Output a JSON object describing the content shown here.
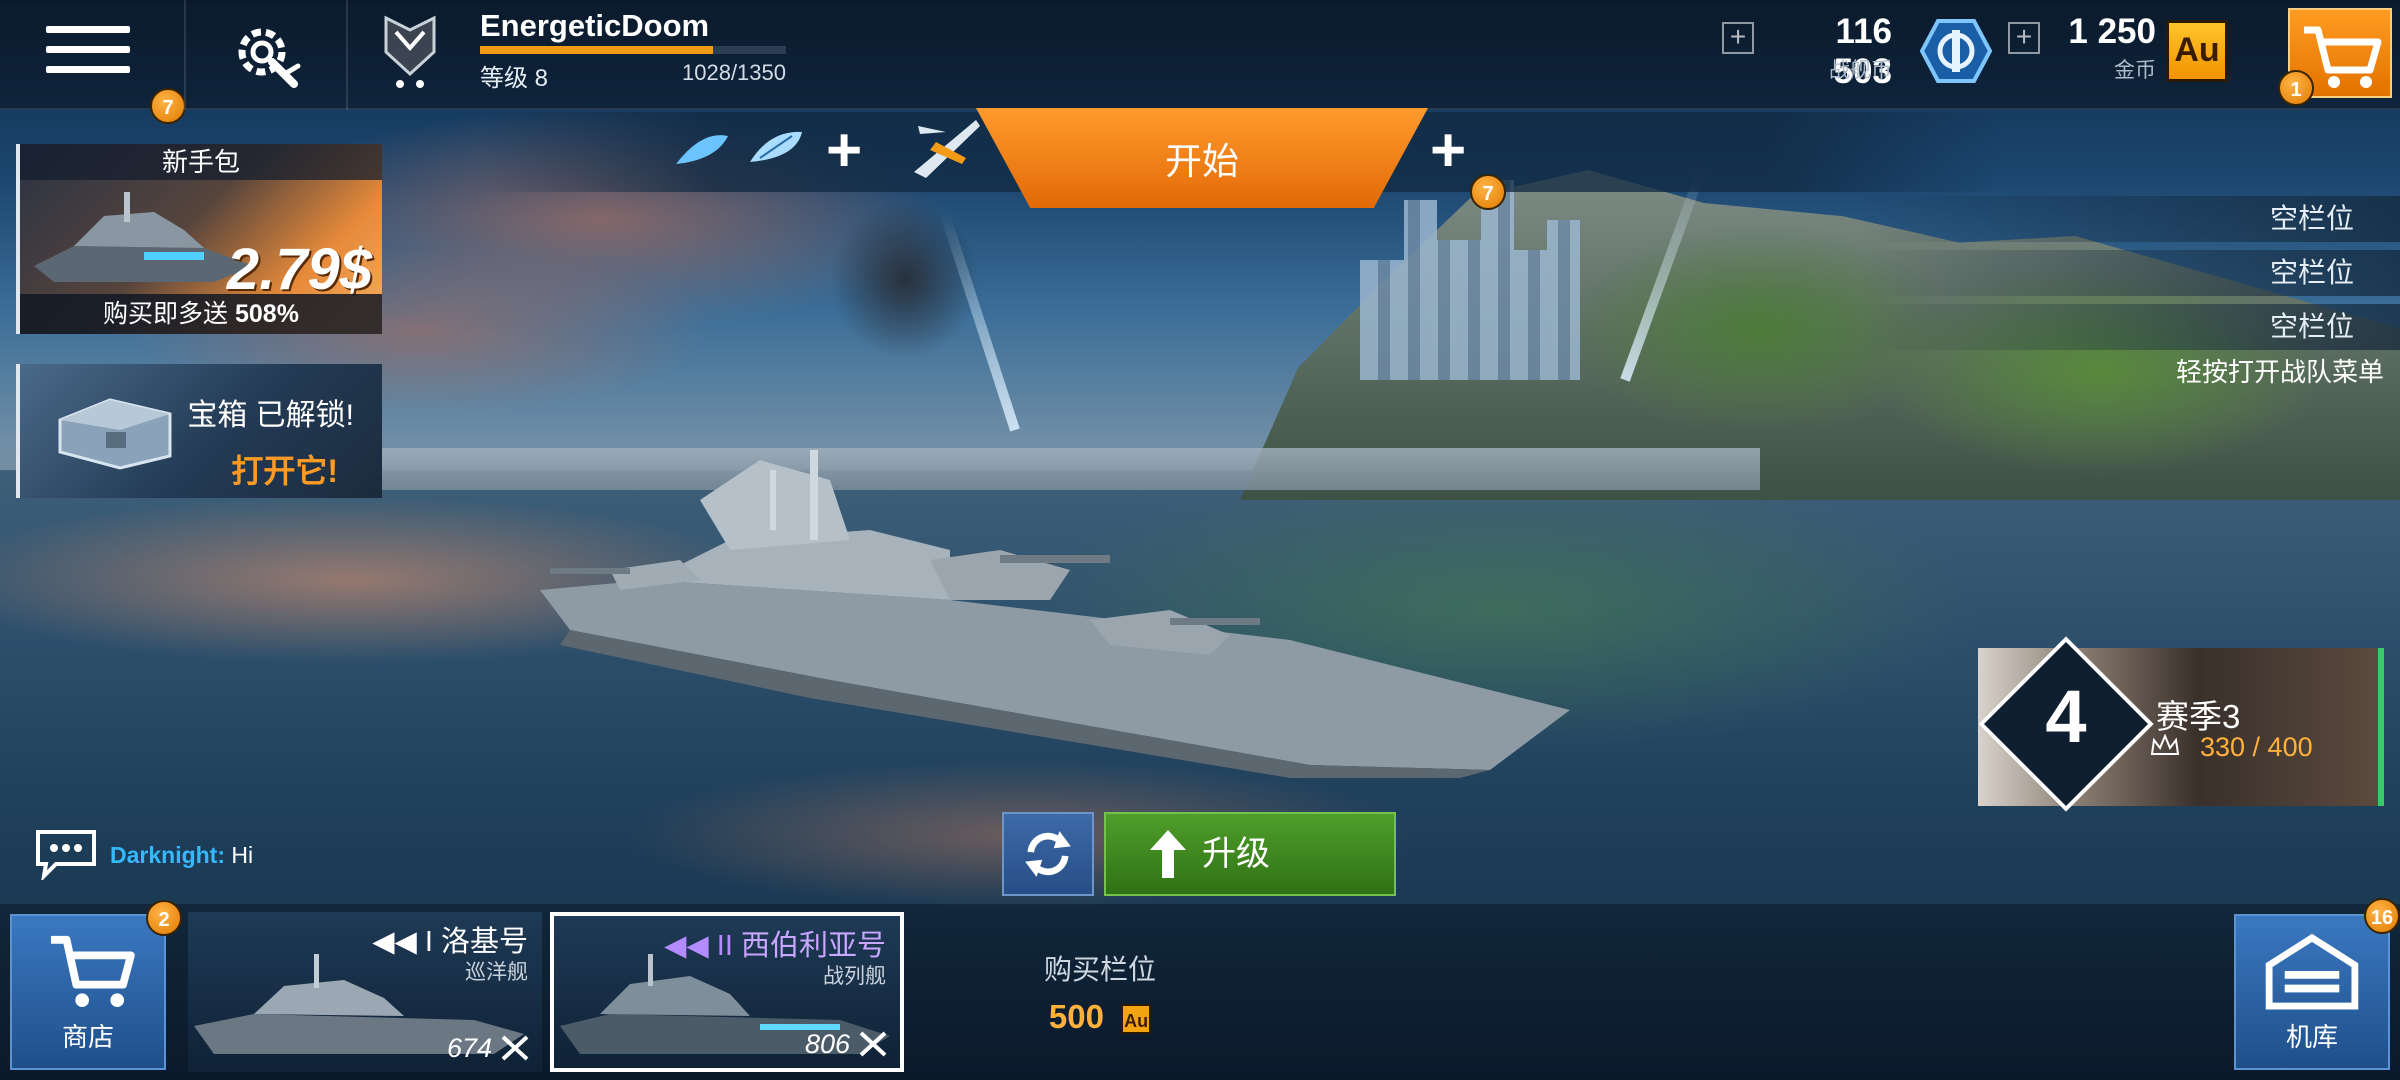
{
  "topbar": {
    "menu_badge": "7",
    "player": {
      "name": "EnergeticDoom",
      "level_label": "等级 8",
      "xp_text": "1028/1350",
      "xp_fraction": 0.761
    },
    "currencies": {
      "credits_amount": "116 503",
      "credits_label": "战舰币",
      "gold_amount": "1 250",
      "gold_label": "金币",
      "gold_icon_text": "Au"
    },
    "cart_badge": "1"
  },
  "battle": {
    "start_label": "开始",
    "slot_plus_label": "+",
    "slot_badge": "7"
  },
  "promos": {
    "starter_pack": {
      "title": "新手包",
      "price": "2.79$",
      "bonus_text": "购买即多送",
      "bonus_percent": "508%"
    },
    "chest": {
      "line1": "宝箱 已解锁!",
      "line2": "打开它!"
    }
  },
  "squad": {
    "slots": [
      "空栏位",
      "空栏位",
      "空栏位"
    ],
    "hint": "轻按打开战队菜单"
  },
  "season": {
    "level": "4",
    "title": "赛季3",
    "progress": "330 / 400"
  },
  "chat": {
    "user": "Darknight:",
    "message": "Hi"
  },
  "actions": {
    "upgrade_label": "升级"
  },
  "bottombar": {
    "shop_label": "商店",
    "shop_badge": "2",
    "hangar_label": "机库",
    "hangar_badge": "16",
    "ships": [
      {
        "tier": "I",
        "name": "洛基号",
        "class": "巡洋舰",
        "power": "674"
      },
      {
        "tier": "II",
        "name": "西伯利亚号",
        "class": "战列舰",
        "power": "806"
      }
    ],
    "buy_slot": {
      "label": "购买栏位",
      "cost": "500",
      "currency": "Au"
    }
  },
  "colors": {
    "accent_orange": "#f39a16",
    "upgrade_green": "#3f8a20",
    "button_blue": "#2d62a4",
    "season_green": "#2fd06a"
  }
}
